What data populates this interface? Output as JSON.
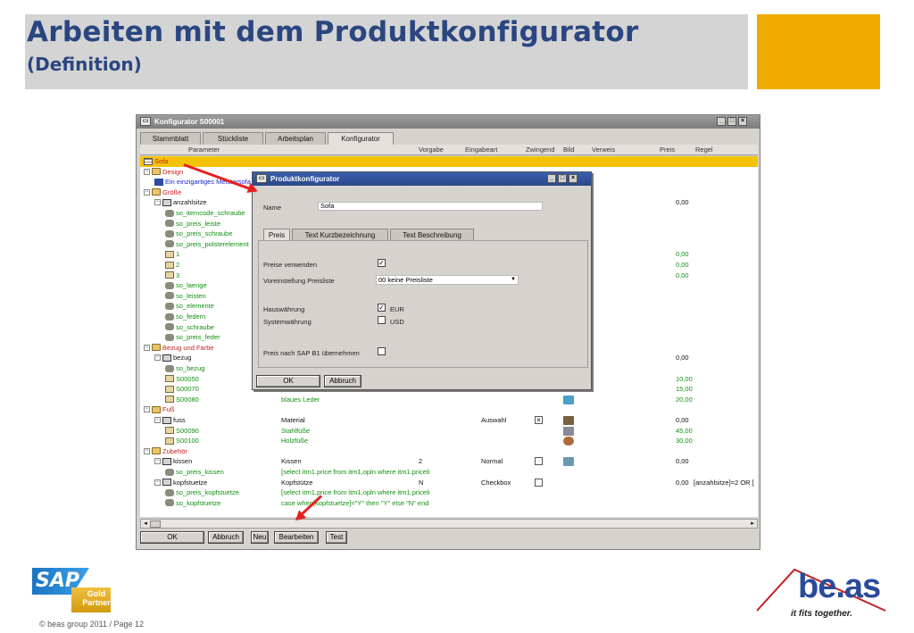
{
  "slide": {
    "title": "Arbeiten mit dem Produktkonfigurator",
    "subtitle": "(Definition)",
    "copyright": "© beas group 2011 / Page 12"
  },
  "window": {
    "title": "Konfigurator S00001",
    "tabs": [
      "Stammblatt",
      "Stückliste",
      "Arbeitsplan",
      "Konfigurator"
    ],
    "active_tab": "Konfigurator",
    "columns": [
      "Parameter",
      "Vorgabe",
      "Eingabeart",
      "Zwingend",
      "Bild",
      "Verweis",
      "Preis",
      "Regel"
    ],
    "rows": [
      {
        "indent": 0,
        "exp": "",
        "icon": "table",
        "name": "Sofa",
        "color": "red",
        "sel": true
      },
      {
        "indent": 0,
        "exp": "-",
        "icon": "folder",
        "name": "Design",
        "color": "red"
      },
      {
        "indent": 1,
        "exp": "",
        "icon": "wand",
        "name": "Ein einzigartiges Meistersofa",
        "color": "blu"
      },
      {
        "indent": 0,
        "exp": "-",
        "icon": "folder",
        "name": "Größe",
        "color": "red"
      },
      {
        "indent": 1,
        "exp": "-",
        "icon": "chair",
        "name": "anzahlsitze",
        "color": "blk",
        "preis": "0,00"
      },
      {
        "indent": 2,
        "exp": "",
        "icon": "key",
        "name": "so_itemcode_schraube",
        "color": "grn"
      },
      {
        "indent": 2,
        "exp": "",
        "icon": "key",
        "name": "so_preis_leiste",
        "color": "grn"
      },
      {
        "indent": 2,
        "exp": "",
        "icon": "key",
        "name": "so_preis_schraube",
        "color": "grn"
      },
      {
        "indent": 2,
        "exp": "",
        "icon": "key",
        "name": "so_preis_polsterelement",
        "color": "grn"
      },
      {
        "indent": 2,
        "exp": "",
        "icon": "box",
        "name": "1",
        "color": "grn",
        "preis": "0,00",
        "pcol": "grn"
      },
      {
        "indent": 2,
        "exp": "",
        "icon": "box",
        "name": "2",
        "color": "grn",
        "preis": "0,00",
        "pcol": "grn"
      },
      {
        "indent": 2,
        "exp": "",
        "icon": "box",
        "name": "3",
        "color": "grn",
        "preis": "0,00",
        "pcol": "grn"
      },
      {
        "indent": 2,
        "exp": "",
        "icon": "key",
        "name": "so_laenge",
        "color": "grn"
      },
      {
        "indent": 2,
        "exp": "",
        "icon": "key",
        "name": "so_leisten",
        "color": "grn"
      },
      {
        "indent": 2,
        "exp": "",
        "icon": "key",
        "name": "so_elemente",
        "color": "grn"
      },
      {
        "indent": 2,
        "exp": "",
        "icon": "key",
        "name": "so_federn",
        "color": "grn"
      },
      {
        "indent": 2,
        "exp": "",
        "icon": "key",
        "name": "so_schraube",
        "color": "grn"
      },
      {
        "indent": 2,
        "exp": "",
        "icon": "key",
        "name": "so_preis_feder",
        "color": "grn"
      },
      {
        "indent": 0,
        "exp": "-",
        "icon": "folder",
        "name": "Bezug und Farbe",
        "color": "red"
      },
      {
        "indent": 1,
        "exp": "-",
        "icon": "chair",
        "name": "bezug",
        "color": "blk",
        "preis": "0,00"
      },
      {
        "indent": 2,
        "exp": "",
        "icon": "key",
        "name": "so_bezug",
        "color": "grn"
      },
      {
        "indent": 2,
        "exp": "",
        "icon": "box",
        "name": "S00050",
        "color": "grn",
        "preis": "10,00",
        "pcol": "grn"
      },
      {
        "indent": 2,
        "exp": "",
        "icon": "box",
        "name": "S00070",
        "color": "grn",
        "preis": "15,00",
        "pcol": "grn"
      },
      {
        "indent": 2,
        "exp": "",
        "icon": "box",
        "name": "S00080",
        "color": "grn",
        "vorgabe": "blaues Leder",
        "vcol": "grn",
        "bild": "leather",
        "preis": "20,00",
        "pcol": "grn"
      },
      {
        "indent": 0,
        "exp": "-",
        "icon": "folder",
        "name": "Fuß",
        "color": "red"
      },
      {
        "indent": 1,
        "exp": "-",
        "icon": "chair",
        "name": "fuss",
        "color": "blk",
        "vorgabe": "Material",
        "vcol": "blk",
        "eingabe": "Auswahl",
        "zwingend": "x",
        "bild": "lamp",
        "preis": "0,00"
      },
      {
        "indent": 2,
        "exp": "",
        "icon": "box",
        "name": "S00090",
        "color": "grn",
        "vorgabe": "Stahlfüße",
        "vcol": "grn",
        "bild": "metal",
        "preis": "45,00",
        "pcol": "grn"
      },
      {
        "indent": 2,
        "exp": "",
        "icon": "box",
        "name": "S00100",
        "color": "grn",
        "vorgabe": "Holzfüße",
        "vcol": "grn",
        "bild": "wood",
        "preis": "30,00",
        "pcol": "grn"
      },
      {
        "indent": 0,
        "exp": "-",
        "icon": "folder",
        "name": "Zubehör",
        "color": "red"
      },
      {
        "indent": 1,
        "exp": "-",
        "icon": "chair",
        "name": "kissen",
        "color": "blk",
        "vorgabe": "Kissen",
        "vcol": "blk",
        "zweite": "2",
        "eingabe": "Normal",
        "zwingend": "o",
        "bild": "pillow",
        "preis": "0,00"
      },
      {
        "indent": 2,
        "exp": "",
        "icon": "key",
        "name": "so_preis_kissen",
        "color": "grn",
        "vorgabe": "[select itm1.price from itm1,opln where itm1.priceli",
        "vcol": "grn"
      },
      {
        "indent": 1,
        "exp": "-",
        "icon": "chair",
        "name": "kopfstuetze",
        "color": "blk",
        "vorgabe": "Kopfstütze",
        "vcol": "blk",
        "zweite": "N",
        "eingabe": "Checkbox",
        "zwingend": "o",
        "preis": "0,00",
        "regel": "[anzahlsitze]=2 OR ["
      },
      {
        "indent": 2,
        "exp": "",
        "icon": "key",
        "name": "so_preis_kopfstuetze",
        "color": "grn",
        "vorgabe": "[select itm1.price from itm1,opln where itm1.priceli",
        "vcol": "grn"
      },
      {
        "indent": 2,
        "exp": "",
        "icon": "key",
        "name": "so_kopfstuetze",
        "color": "grn",
        "vorgabe": "case when[kopfstuetze]=\"Y\" then \"Y\" else \"N\" end",
        "vcol": "grn"
      }
    ],
    "buttons": {
      "ok": "OK",
      "abbruch": "Abbruch",
      "neu": "Neu",
      "bearbeiten": "Bearbeiten",
      "test": "Test"
    }
  },
  "dialog": {
    "title": "Produktkonfigurator",
    "name_label": "Name",
    "name_value": "Sofa",
    "tabs": [
      "Preis",
      "Text Kurzbezeichnung",
      "Text Beschreibung"
    ],
    "preise_label": "Preise verwenden",
    "preise_checked": "✓",
    "preisliste_label": "Voreinstellung Preisliste",
    "preisliste_value": "00 keine Preisliste",
    "hauswaehrung_label": "Hauswährung",
    "hauswaehrung_check": "✓",
    "hauswaehrung_value": "EUR",
    "systemwaehrung_label": "Systemwährung",
    "systemwaehrung_value": "USD",
    "sap_label": "Preis nach SAP B1 übernehmen",
    "ok": "OK",
    "abbruch": "Abbruch"
  },
  "logos": {
    "sap": "SAP",
    "sap_badge": "Gold Partner",
    "beas": "be.as",
    "beas_tagline": "it fits together."
  },
  "colors": {
    "title": "#2a4680",
    "accent": "#f0ab00",
    "selected": "#f5c20a",
    "arrow": "#e62020"
  }
}
